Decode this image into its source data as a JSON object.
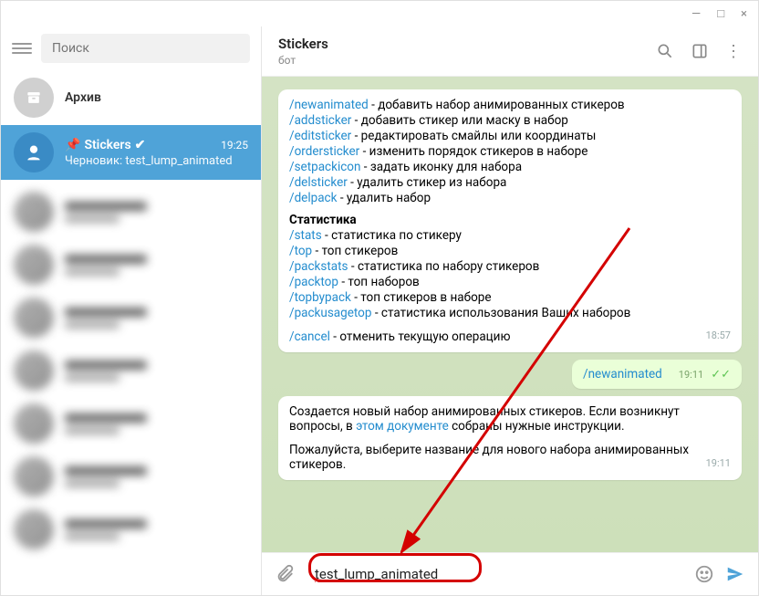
{
  "window": {
    "min": "—",
    "max": "□",
    "close": "×"
  },
  "sidebar": {
    "search_placeholder": "Поиск",
    "archive": "Архив",
    "active": {
      "name": "Stickers",
      "verified": "✔",
      "pin": "📌",
      "time": "19:25",
      "draft_prefix": "Черновик:",
      "draft_text": " test_lump_animated"
    }
  },
  "header": {
    "title": "Stickers",
    "subtitle": "бот"
  },
  "commands": {
    "newanimated": {
      "c": "/newanimated",
      "d": " - добавить набор анимированных стикеров"
    },
    "addsticker": {
      "c": "/addsticker",
      "d": " - добавить стикер или маску в набор"
    },
    "editsticker": {
      "c": "/editsticker",
      "d": " - редактировать смайлы или координаты"
    },
    "ordersticker": {
      "c": "/ordersticker",
      "d": " - изменить порядок стикеров в наборе"
    },
    "setpackicon": {
      "c": "/setpackicon",
      "d": " - задать иконку для набора"
    },
    "delsticker": {
      "c": "/delsticker",
      "d": " - удалить стикер из набора"
    },
    "delpack": {
      "c": "/delpack",
      "d": " - удалить набор"
    },
    "stat_header": "Статистика",
    "stats": {
      "c": "/stats",
      "d": " - статистика по стикеру"
    },
    "top": {
      "c": "/top",
      "d": " - топ стикеров"
    },
    "packstats": {
      "c": "/packstats",
      "d": " - статистика по набору стикеров"
    },
    "packtop": {
      "c": "/packtop",
      "d": " - топ наборов"
    },
    "topbypack": {
      "c": "/topbypack",
      "d": " - топ стикеров в наборе"
    },
    "packusagetop": {
      "c": "/packusagetop",
      "d": " - статистика использования Ваших наборов"
    },
    "cancel": {
      "c": "/cancel",
      "d": " - отменить текущую операцию"
    },
    "time1": "18:57"
  },
  "out_msg": {
    "text": "/newanimated",
    "time": "19:11"
  },
  "reply": {
    "p1a": "Создается новый набор анимированных стикеров. Если возникнут вопросы, в ",
    "p1link": "этом документе",
    "p1b": " собраны нужные инструкции.",
    "p2": "Пожалуйста, выберите название для нового набора анимированных стикеров.",
    "time": "19:11"
  },
  "input": {
    "value": "test_lump_animated"
  }
}
